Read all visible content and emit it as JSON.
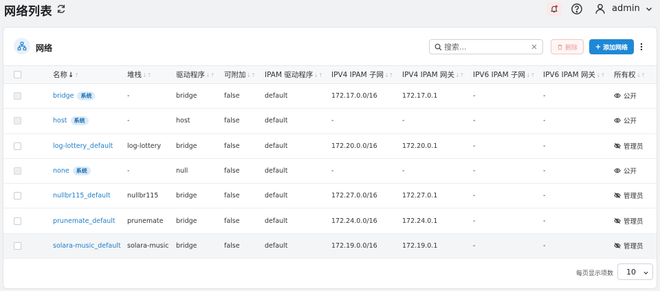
{
  "header": {
    "title": "网络列表",
    "user": "admin"
  },
  "card": {
    "title": "网络",
    "search_placeholder": "搜索...",
    "delete_label": "删除",
    "add_label": "添加网络"
  },
  "table": {
    "columns": [
      "名称",
      "堆栈",
      "驱动程序",
      "可附加",
      "IPAM 驱动程序",
      "IPV4 IPAM 子网",
      "IPV4 IPAM 网关",
      "IPV6 IPAM 子网",
      "IPV6 IPAM 网关",
      "所有权"
    ],
    "sort_active_symbol": "↓",
    "sort_symbol": "↓↑",
    "rows": [
      {
        "name": "bridge",
        "badge": "系统",
        "stack": "-",
        "driver": "bridge",
        "attachable": "false",
        "ipam_driver": "default",
        "ipv4_subnet": "172.17.0.0/16",
        "ipv4_gateway": "172.17.0.1",
        "ipv6_subnet": "-",
        "ipv6_gateway": "-",
        "ownership": "公开",
        "ownership_icon": "eye-icon",
        "system": true
      },
      {
        "name": "host",
        "badge": "系统",
        "stack": "-",
        "driver": "host",
        "attachable": "false",
        "ipam_driver": "default",
        "ipv4_subnet": "-",
        "ipv4_gateway": "-",
        "ipv6_subnet": "-",
        "ipv6_gateway": "-",
        "ownership": "公开",
        "ownership_icon": "eye-icon",
        "system": true
      },
      {
        "name": "log-lottery_default",
        "badge": "",
        "stack": "log-lottery",
        "driver": "bridge",
        "attachable": "false",
        "ipam_driver": "default",
        "ipv4_subnet": "172.20.0.0/16",
        "ipv4_gateway": "172.20.0.1",
        "ipv6_subnet": "-",
        "ipv6_gateway": "-",
        "ownership": "管理员",
        "ownership_icon": "eye-off-icon",
        "system": false
      },
      {
        "name": "none",
        "badge": "系统",
        "stack": "-",
        "driver": "null",
        "attachable": "false",
        "ipam_driver": "default",
        "ipv4_subnet": "-",
        "ipv4_gateway": "-",
        "ipv6_subnet": "-",
        "ipv6_gateway": "-",
        "ownership": "公开",
        "ownership_icon": "eye-icon",
        "system": true
      },
      {
        "name": "nullbr115_default",
        "badge": "",
        "stack": "nullbr115",
        "driver": "bridge",
        "attachable": "false",
        "ipam_driver": "default",
        "ipv4_subnet": "172.27.0.0/16",
        "ipv4_gateway": "172.27.0.1",
        "ipv6_subnet": "-",
        "ipv6_gateway": "-",
        "ownership": "管理员",
        "ownership_icon": "eye-off-icon",
        "system": false
      },
      {
        "name": "prunemate_default",
        "badge": "",
        "stack": "prunemate",
        "driver": "bridge",
        "attachable": "false",
        "ipam_driver": "default",
        "ipv4_subnet": "172.24.0.0/16",
        "ipv4_gateway": "172.24.0.1",
        "ipv6_subnet": "-",
        "ipv6_gateway": "-",
        "ownership": "管理员",
        "ownership_icon": "eye-off-icon",
        "system": false
      },
      {
        "name": "solara-music_default",
        "badge": "",
        "stack": "solara-music",
        "driver": "bridge",
        "attachable": "false",
        "ipam_driver": "default",
        "ipv4_subnet": "172.19.0.0/16",
        "ipv4_gateway": "172.19.0.1",
        "ipv6_subnet": "-",
        "ipv6_gateway": "-",
        "ownership": "管理员",
        "ownership_icon": "eye-off-icon",
        "system": false
      }
    ]
  },
  "pager": {
    "label": "每页显示项数",
    "value": "10"
  },
  "colors": {
    "accent": "#1e88d6",
    "link": "#1e7dc8",
    "badge_bg": "#dcebf8",
    "danger_light": "#fff5f5"
  }
}
